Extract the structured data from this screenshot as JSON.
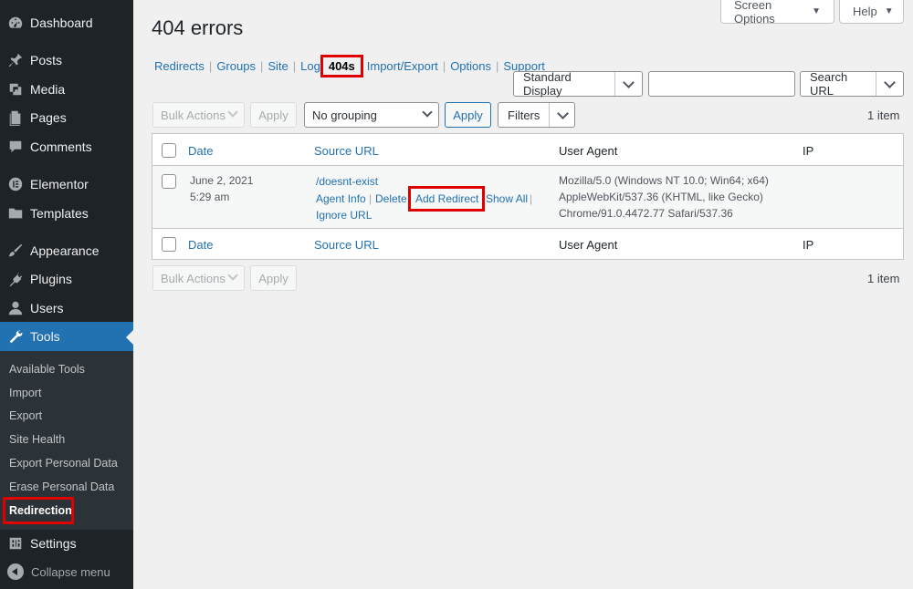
{
  "sidebar": {
    "items": [
      {
        "label": "Dashboard",
        "icon": "dashboard-icon"
      },
      {
        "label": "Posts",
        "icon": "pin-icon"
      },
      {
        "label": "Media",
        "icon": "media-icon"
      },
      {
        "label": "Pages",
        "icon": "pages-icon"
      },
      {
        "label": "Comments",
        "icon": "comments-icon"
      },
      {
        "label": "Elementor",
        "icon": "elementor-icon"
      },
      {
        "label": "Templates",
        "icon": "folder-icon"
      },
      {
        "label": "Appearance",
        "icon": "brush-icon"
      },
      {
        "label": "Plugins",
        "icon": "plug-icon"
      },
      {
        "label": "Users",
        "icon": "user-icon"
      },
      {
        "label": "Tools",
        "icon": "wrench-icon"
      }
    ],
    "submenu": [
      "Available Tools",
      "Import",
      "Export",
      "Site Health",
      "Export Personal Data",
      "Erase Personal Data",
      "Redirection"
    ],
    "settings": "Settings",
    "collapse": "Collapse menu",
    "accent": "#2271b1"
  },
  "top": {
    "screen_options": "Screen Options",
    "help": "Help"
  },
  "page_title": "404 errors",
  "subnav": [
    "Redirects",
    "Groups",
    "Site",
    "Log",
    "404s",
    "Import/Export",
    "Options",
    "Support"
  ],
  "search": {
    "display": "Standard Display",
    "button": "Search URL",
    "value": ""
  },
  "toolbar": {
    "bulk_actions": "Bulk Actions",
    "apply": "Apply",
    "grouping": "No grouping",
    "filters": "Filters",
    "count": "1 item"
  },
  "table": {
    "columns": [
      "Date",
      "Source URL",
      "User Agent",
      "IP"
    ],
    "row": {
      "date": "June 2, 2021",
      "time": "5:29 am",
      "url": "/doesnt-exist",
      "actions": [
        "Agent Info",
        "Delete",
        "Add Redirect",
        "Show All",
        "Ignore URL"
      ],
      "agent": [
        "Mozilla/5.0 (Windows NT 10.0; Win64; x64)",
        "AppleWebKit/537.36 (KHTML, like Gecko)",
        "Chrome/91.0.4472.77 Safari/537.36"
      ],
      "ip": ""
    }
  },
  "highlight_color": "#e00000"
}
